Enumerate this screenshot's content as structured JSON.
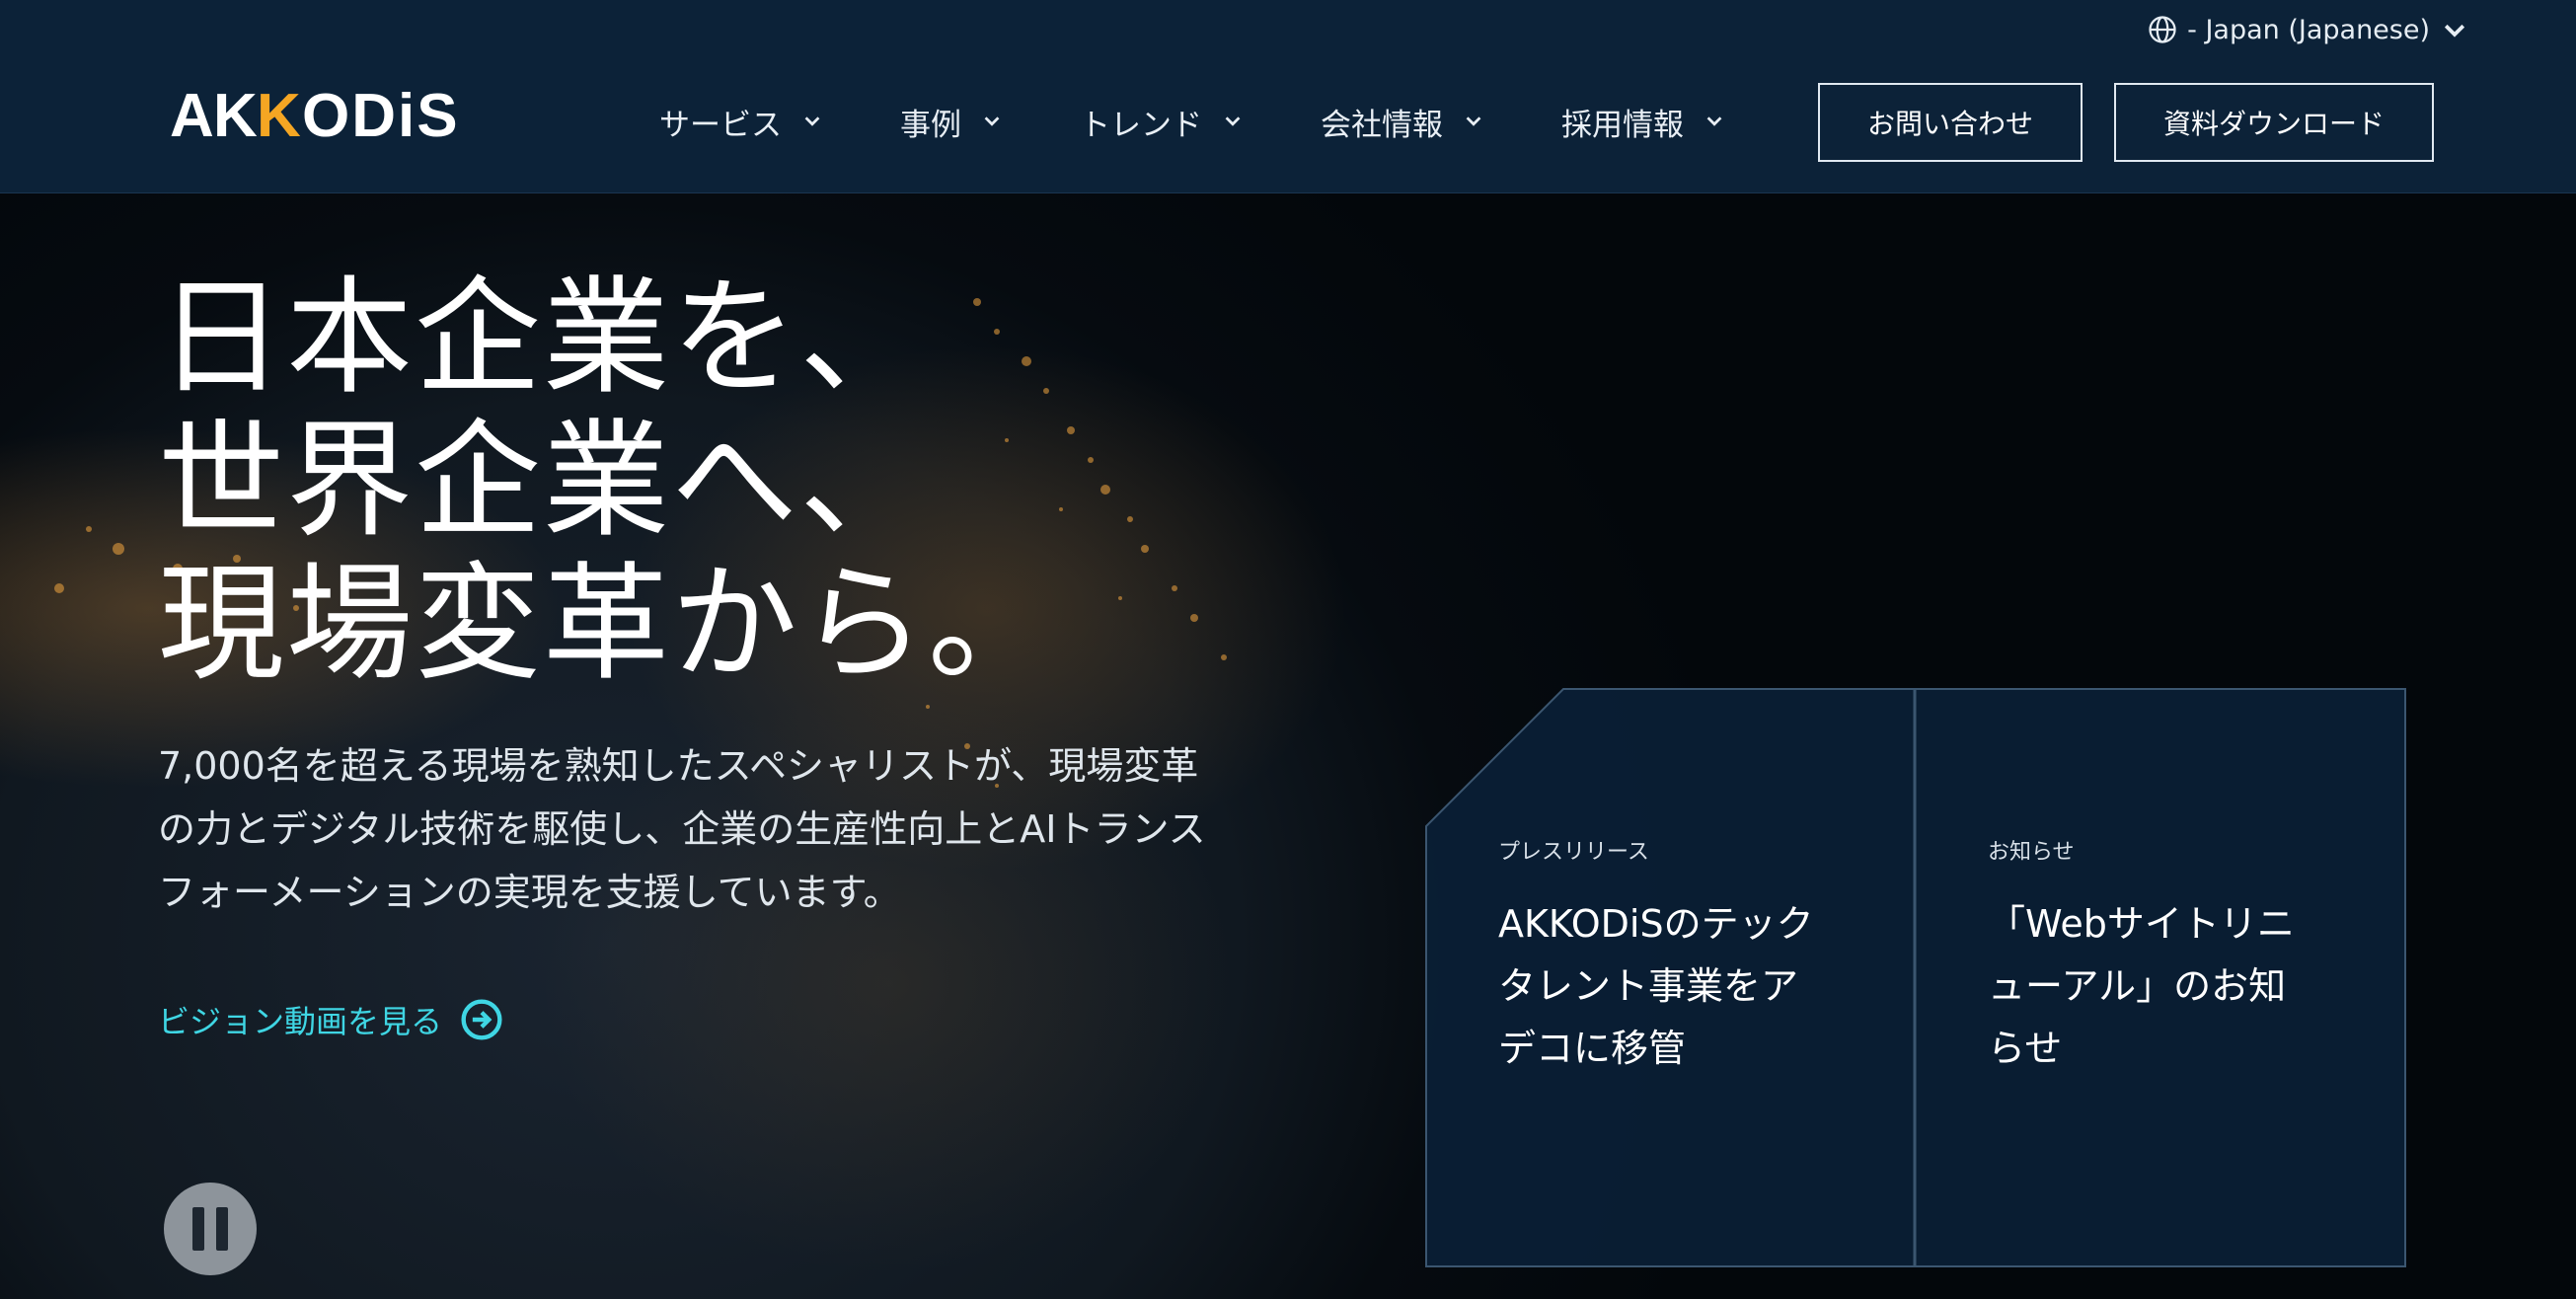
{
  "header": {
    "language": "- Japan (Japanese)",
    "logo_text": "AKKODiS",
    "nav": [
      {
        "label": "サービス"
      },
      {
        "label": "事例"
      },
      {
        "label": "トレンド"
      },
      {
        "label": "会社情報"
      },
      {
        "label": "採用情報"
      }
    ],
    "contact_label": "お問い合わせ",
    "download_label": "資料ダウンロード"
  },
  "hero": {
    "headline": [
      "日本企業を、",
      "世界企業へ、",
      "現場変革から。"
    ],
    "lead": [
      "7,000名を超える現場を熟知したスペシャリストが、現場変革",
      "の力とデジタル技術を駆使し、企業の生産性向上とAIトランス",
      "フォーメーションの実現を支援しています。"
    ],
    "vision_link": "ビジョン動画を見る"
  },
  "cards": [
    {
      "tag": "プレスリリース",
      "title": [
        "AKKODiSのテック",
        "タレント事業をア",
        "デコに移管"
      ]
    },
    {
      "tag": "お知らせ",
      "title": [
        "「Webサイトリニ",
        "ューアル」のお知",
        "らせ"
      ]
    }
  ],
  "colors": {
    "header_bg": "#0c2238",
    "accent_cyan": "#3fd6e4",
    "logo_orange": "#f5a623",
    "card_bg": "#0a2036"
  },
  "icons": {
    "language": "globe-icon",
    "nav_caret": "chevron-down-icon",
    "vision_link": "arrow-right-circle-icon",
    "pause": "pause-icon"
  }
}
